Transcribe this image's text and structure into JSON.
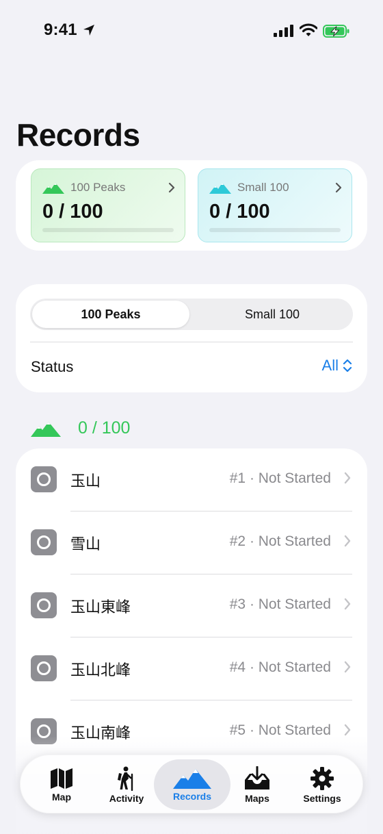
{
  "status_bar": {
    "time": "9:41"
  },
  "page": {
    "title": "Records"
  },
  "summary": {
    "tiles": [
      {
        "label": "100 Peaks",
        "count": "0 / 100",
        "progress": 0,
        "color": "#34c759"
      },
      {
        "label": "Small 100",
        "count": "0 / 100",
        "progress": 0,
        "color": "#2ec9d8"
      }
    ]
  },
  "filter": {
    "segments": [
      "100 Peaks",
      "Small 100"
    ],
    "selected_segment": "100 Peaks",
    "status_label": "Status",
    "status_value": "All"
  },
  "section": {
    "count": "0 / 100"
  },
  "list": {
    "rows": [
      {
        "name": "玉山",
        "meta": "#1 · Not Started"
      },
      {
        "name": "雪山",
        "meta": "#2 · Not Started"
      },
      {
        "name": "玉山東峰",
        "meta": "#3 · Not Started"
      },
      {
        "name": "玉山北峰",
        "meta": "#4 · Not Started"
      },
      {
        "name": "玉山南峰",
        "meta": "#5 · Not Started"
      }
    ]
  },
  "tab_bar": {
    "tabs": [
      {
        "label": "Map",
        "icon": "map-icon"
      },
      {
        "label": "Activity",
        "icon": "hiker-icon"
      },
      {
        "label": "Records",
        "icon": "mountains-icon"
      },
      {
        "label": "Maps",
        "icon": "download-tray-icon"
      },
      {
        "label": "Settings",
        "icon": "gear-icon"
      }
    ],
    "active": "Records"
  },
  "colors": {
    "accent": "#1a7fe8",
    "green": "#34c759",
    "teal": "#2ec9d8"
  }
}
